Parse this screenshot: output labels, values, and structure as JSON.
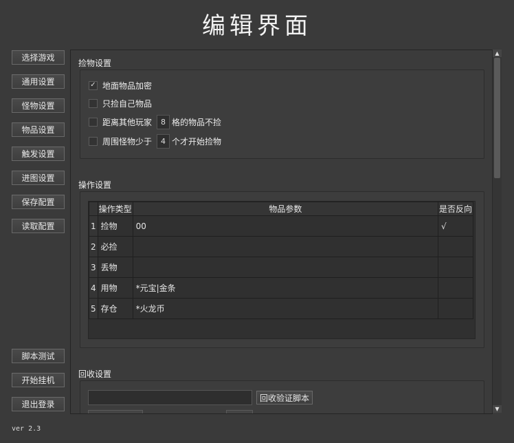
{
  "window": {
    "title": "编辑界面",
    "version": "ver 2.3"
  },
  "sidebar": {
    "top_buttons": [
      "选择游戏",
      "通用设置",
      "怪物设置",
      "物品设置",
      "触发设置",
      "进图设置",
      "保存配置",
      "读取配置"
    ],
    "bottom_buttons": [
      "脚本测试",
      "开始挂机",
      "退出登录"
    ]
  },
  "pickup": {
    "title": "捡物设置",
    "encrypt": {
      "label": "地面物品加密",
      "checked": true
    },
    "own_only": {
      "label": "只捡自己物品",
      "checked": false
    },
    "distance": {
      "prefix": "距离其他玩家",
      "value": "8",
      "suffix": "格的物品不捡",
      "checked": false
    },
    "monsters": {
      "prefix": "周围怪物少于",
      "value": "4",
      "suffix": "个才开始捡物",
      "checked": false
    },
    "check_mark": "✓"
  },
  "operations": {
    "title": "操作设置",
    "headers": [
      "操作类型",
      "物品参数",
      "是否反向"
    ],
    "rows": [
      {
        "index": "1",
        "type": "捡物",
        "param": "00",
        "reverse": "√"
      },
      {
        "index": "2",
        "type": "必捡",
        "param": "",
        "reverse": ""
      },
      {
        "index": "3",
        "type": "丢物",
        "param": "",
        "reverse": ""
      },
      {
        "index": "4",
        "type": "用物",
        "param": "*元宝|金条",
        "reverse": ""
      },
      {
        "index": "5",
        "type": "存仓",
        "param": "*火龙币",
        "reverse": ""
      }
    ]
  },
  "recycle": {
    "title": "回收设置",
    "input_value": "",
    "verify_button": "回收验证脚本"
  },
  "scrollbar": {
    "up": "▲",
    "down": "▼"
  }
}
